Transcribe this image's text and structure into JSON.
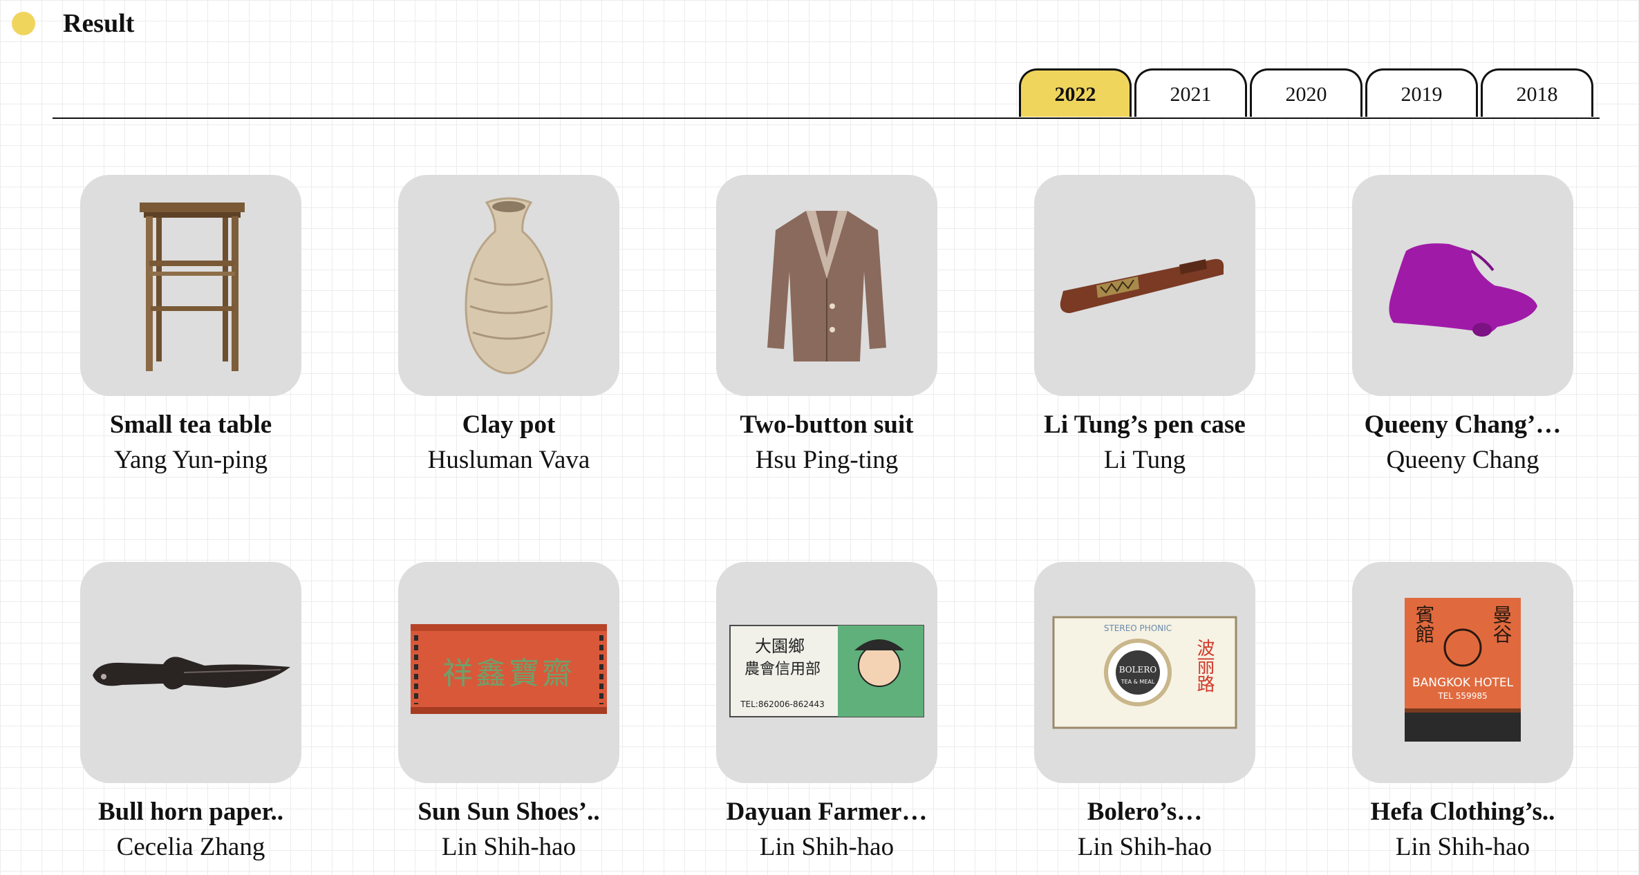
{
  "header": {
    "title": "Result"
  },
  "tabs": [
    {
      "label": "2022",
      "active": true
    },
    {
      "label": "2021",
      "active": false
    },
    {
      "label": "2020",
      "active": false
    },
    {
      "label": "2019",
      "active": false
    },
    {
      "label": "2018",
      "active": false
    }
  ],
  "items": [
    {
      "title": "Small tea table",
      "author": "Yang Yun-ping",
      "image": "wooden-stool-image"
    },
    {
      "title": "Clay pot",
      "author": "Husluman Vava",
      "image": "clay-vase-image"
    },
    {
      "title": "Two-button suit",
      "author": "Hsu Ping-ting",
      "image": "suit-jacket-image"
    },
    {
      "title": "Li Tung’s pen case",
      "author": "Li Tung",
      "image": "pen-case-image"
    },
    {
      "title": "Queeny Chang’…",
      "author": "Queeny Chang",
      "image": "knitted-bag-image"
    },
    {
      "title": "Bull horn paper..",
      "author": "Cecelia Zhang",
      "image": "paper-knife-image"
    },
    {
      "title": "Sun Sun Shoes’..",
      "author": "Lin Shih-hao",
      "image": "matchbox-red-image",
      "image_text": "祥鑫寶齋"
    },
    {
      "title": "Dayuan Farmer…",
      "author": "Lin Shih-hao",
      "image": "matchbox-green-image",
      "image_text": [
        "大園鄉",
        "農會信用部",
        "TEL:862006-862443"
      ]
    },
    {
      "title": "Bolero’s…",
      "author": "Lin Shih-hao",
      "image": "matchbox-bolero-image",
      "image_text": [
        "STEREO PHONIC",
        "BOLERO",
        "TEA & MEAL",
        "波丽路"
      ]
    },
    {
      "title": "Hefa Clothing’s..",
      "author": "Lin Shih-hao",
      "image": "matchbox-hotel-image",
      "image_text": [
        "曼谷",
        "賓館",
        "BANGKOK HOTEL",
        "TEL 559985"
      ]
    }
  ]
}
